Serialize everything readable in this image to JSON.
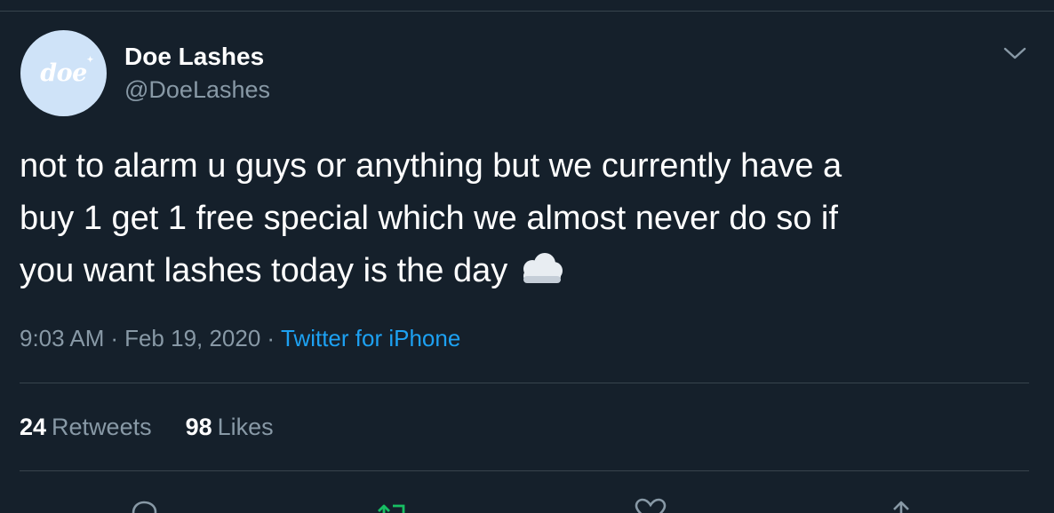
{
  "author": {
    "display_name": "Doe Lashes",
    "handle": "@DoeLashes",
    "avatar_logo_text": "doe"
  },
  "tweet": {
    "lines": [
      "not to alarm u guys or anything but we currently have a",
      "buy 1 get 1 free special which we almost never do so if",
      "you want lashes today is the day"
    ],
    "emoji": "cloud-icon"
  },
  "meta": {
    "time": "9:03 AM",
    "separator": "·",
    "date": "Feb 19, 2020",
    "source": "Twitter for iPhone"
  },
  "stats": {
    "retweets_count": "24",
    "retweets_label": "Retweets",
    "likes_count": "98",
    "likes_label": "Likes"
  },
  "actions": [
    "reply-icon",
    "retweet-icon",
    "like-icon",
    "share-icon"
  ],
  "colors": {
    "background": "#15202b",
    "text_primary": "#ffffff",
    "text_secondary": "#8899a6",
    "link": "#1da1f2",
    "border": "#38444d",
    "retweet_green": "#17bf63",
    "avatar_bg": "#cfe3f8"
  }
}
